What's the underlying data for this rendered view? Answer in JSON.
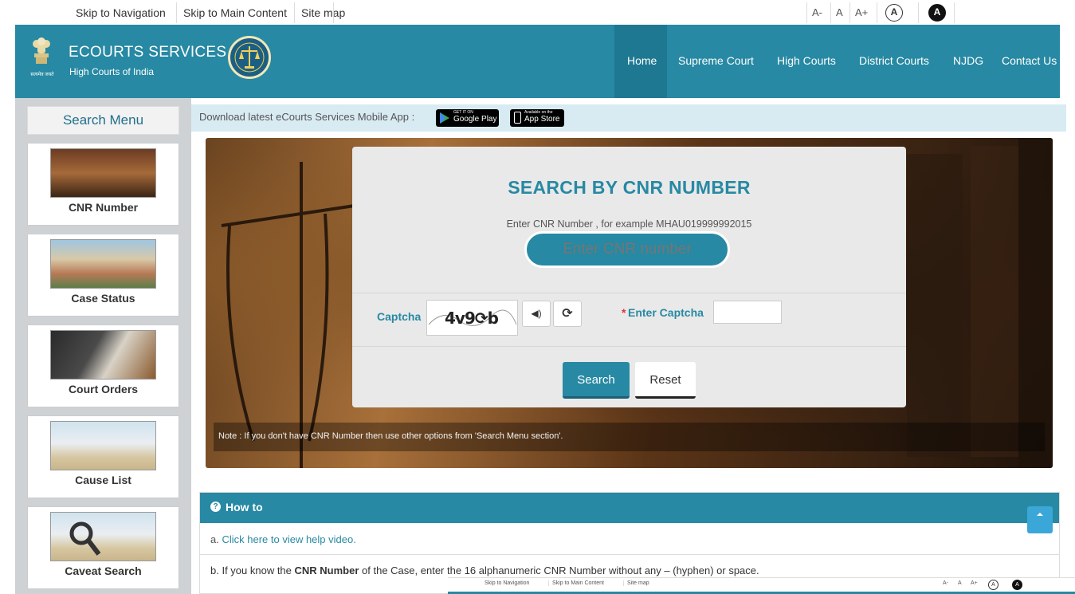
{
  "topbar": {
    "skip_nav": "Skip to Navigation",
    "skip_main": "Skip to Main Content",
    "sitemap": "Site map",
    "font_small": "A-",
    "font_normal": "A",
    "font_large": "A+",
    "contrast_normal": "A",
    "contrast_dark": "A"
  },
  "header": {
    "title": "ECOURTS SERVICES",
    "subtitle": "High Courts of India",
    "emblem_text": "सत्यमेव जयते",
    "nav": [
      "Home",
      "Supreme Court",
      "High Courts",
      "District Courts",
      "NJDG",
      "Contact Us"
    ]
  },
  "sidebar": {
    "title": "Search Menu",
    "items": [
      "CNR Number",
      "Case Status",
      "Court Orders",
      "Cause List",
      "Caveat Search"
    ]
  },
  "appbar": {
    "text": "Download latest eCourts Services Mobile App :",
    "google_small": "GET IT ON",
    "google_big": "Google Play",
    "apple_small": "Available on the",
    "apple_big": "App Store"
  },
  "search": {
    "heading": "SEARCH BY CNR NUMBER",
    "hint": "Enter CNR Number , for example MHAU019999992015",
    "placeholder": "Enter CNR number",
    "captcha_label": "Captcha",
    "captcha_value": "4v9⟳b",
    "enter_captcha_star": "*",
    "enter_captcha": "Enter Captcha",
    "search_btn": "Search",
    "reset_btn": "Reset",
    "note": "Note : If you don't have CNR Number then use other options from 'Search Menu section'."
  },
  "howto": {
    "title": "How to",
    "line_a_prefix": "a. ",
    "line_a_link": "Click here to view help video.",
    "line_b_pre": "b. If you know the ",
    "line_b_bold": "CNR Number",
    "line_b_post": " of the Case, enter the 16 alphanumeric CNR Number without any – (hyphen) or space."
  },
  "overlay": {
    "skip_nav": "Skip to Navigation",
    "skip_main": "Skip to Main Content",
    "sitemap": "Site map",
    "font_small": "A-",
    "font_normal": "A",
    "font_large": "A+",
    "contrast_normal": "A",
    "contrast_dark": "A"
  },
  "colors": {
    "primary": "#2789a3",
    "accent": "#dd3333",
    "sidebar": "#cfd2d4",
    "appbar": "#d8ebf3"
  }
}
